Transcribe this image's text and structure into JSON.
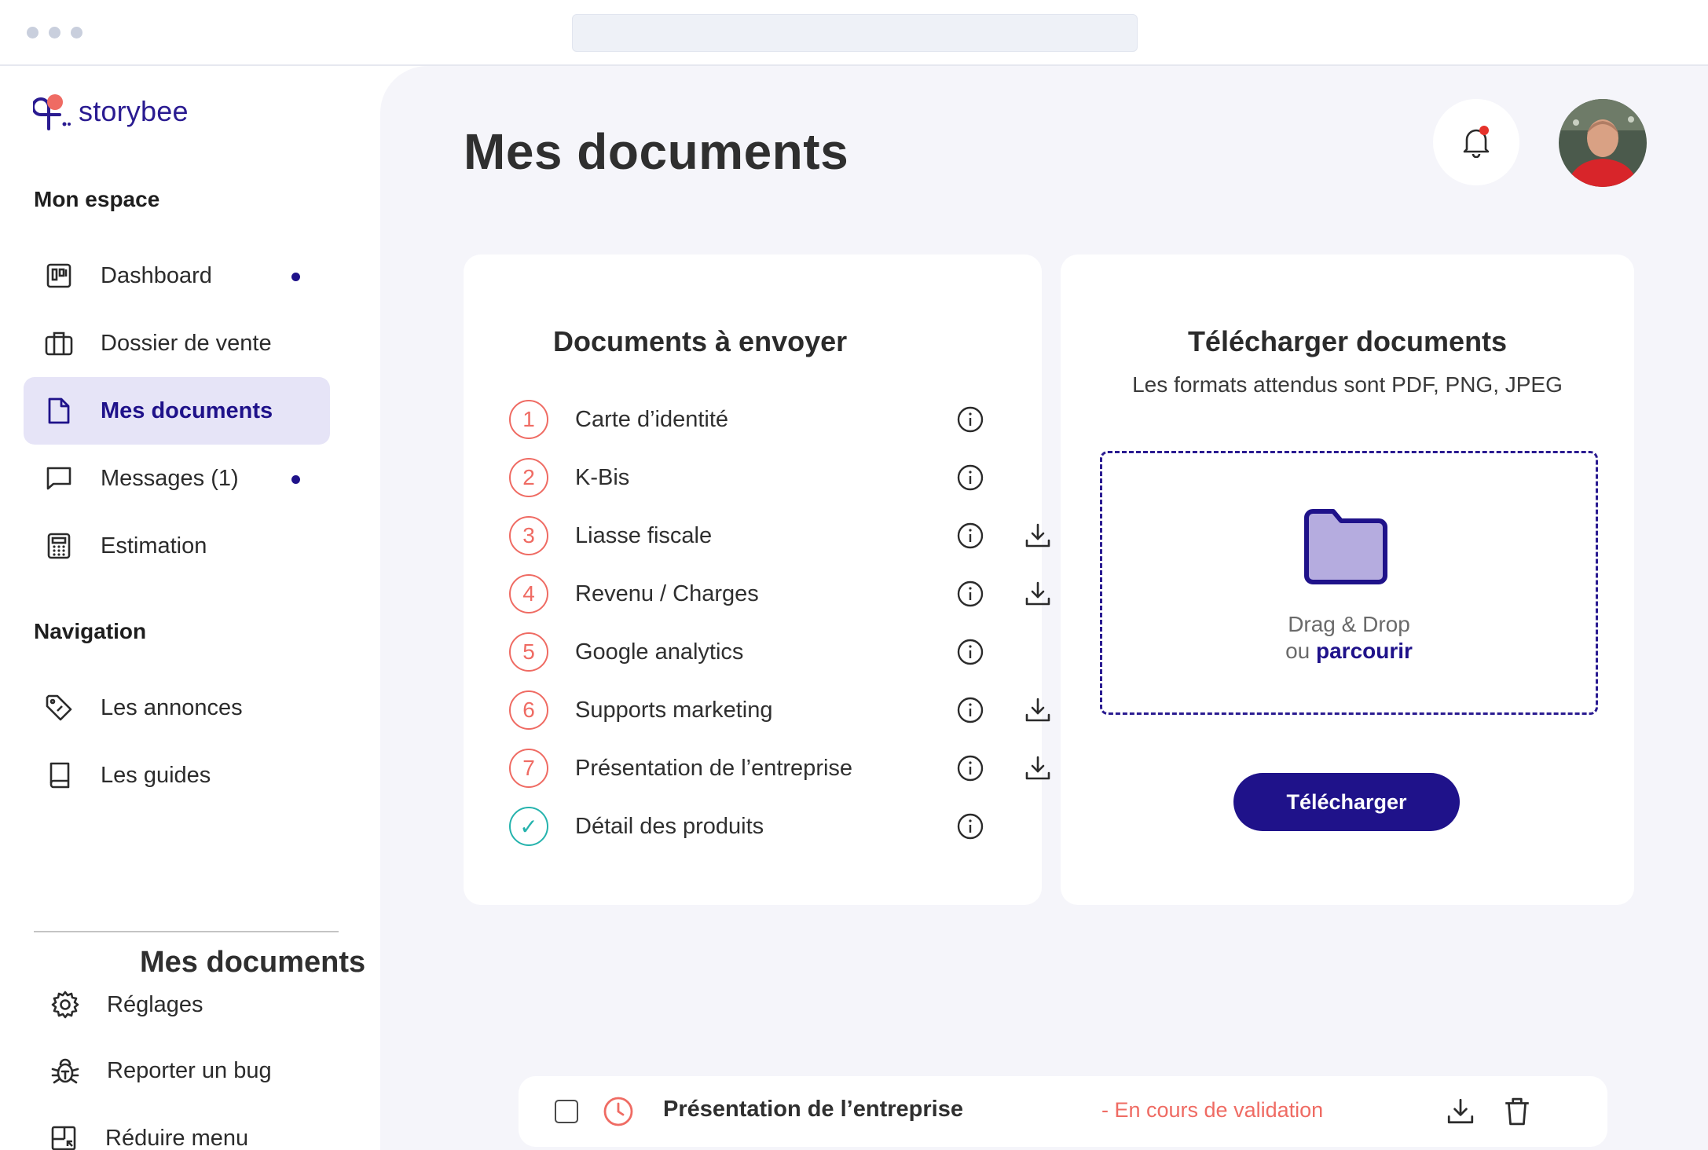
{
  "brand": {
    "name": "storybee",
    "color": "#2a1b91"
  },
  "sidebar": {
    "section_space": "Mon espace",
    "space_items": [
      {
        "label": "Dashboard",
        "icon": "dashboard-icon",
        "has_dot": true
      },
      {
        "label": "Dossier de vente",
        "icon": "briefcase-icon",
        "has_dot": false
      },
      {
        "label": "Mes documents",
        "icon": "document-icon",
        "has_dot": false,
        "active": true
      },
      {
        "label": "Messages (1)",
        "icon": "message-icon",
        "has_dot": true
      },
      {
        "label": "Estimation",
        "icon": "calculator-icon",
        "has_dot": false
      }
    ],
    "section_nav": "Navigation",
    "nav_items": [
      {
        "label": "Les annonces",
        "icon": "tag-icon"
      },
      {
        "label": "Les guides",
        "icon": "book-icon"
      }
    ],
    "bottom_items": [
      {
        "label": "Réglages",
        "icon": "gear-icon"
      },
      {
        "label": "Reporter un bug",
        "icon": "bug-icon"
      },
      {
        "label": "Réduire menu",
        "icon": "collapse-menu-icon"
      }
    ]
  },
  "header": {
    "title": "Mes documents"
  },
  "to_send": {
    "title": "Documents à envoyer",
    "items": [
      {
        "number": "1",
        "label": "Carte d’identité",
        "downloadable": false,
        "done": false
      },
      {
        "number": "2",
        "label": "K-Bis",
        "downloadable": false,
        "done": false
      },
      {
        "number": "3",
        "label": "Liasse fiscale",
        "downloadable": true,
        "done": false
      },
      {
        "number": "4",
        "label": "Revenu / Charges",
        "downloadable": true,
        "done": false
      },
      {
        "number": "5",
        "label": "Google analytics",
        "downloadable": false,
        "done": false
      },
      {
        "number": "6",
        "label": "Supports marketing",
        "downloadable": true,
        "done": false
      },
      {
        "number": "7",
        "label": "Présentation de l’entreprise",
        "downloadable": true,
        "done": false
      },
      {
        "number": "✓",
        "label": "Détail des produits",
        "downloadable": false,
        "done": true
      }
    ]
  },
  "upload": {
    "title": "Télécharger documents",
    "formats": "Les formats attendus sont PDF, PNG, JPEG",
    "drop_text": "Drag & Drop",
    "or_text": "ou ",
    "browse_link": "parcourir",
    "button": "Télécharger"
  },
  "my_documents": {
    "title": "Mes documents",
    "files": [
      {
        "name": "Présentation de l’entreprise",
        "status": "- En cours de validation"
      }
    ]
  },
  "colors": {
    "primary": "#1f128a",
    "accent_red": "#ef6b63",
    "success_teal": "#25b3ad",
    "background": "#f5f5fa",
    "active_bg": "#e6e4f7"
  }
}
